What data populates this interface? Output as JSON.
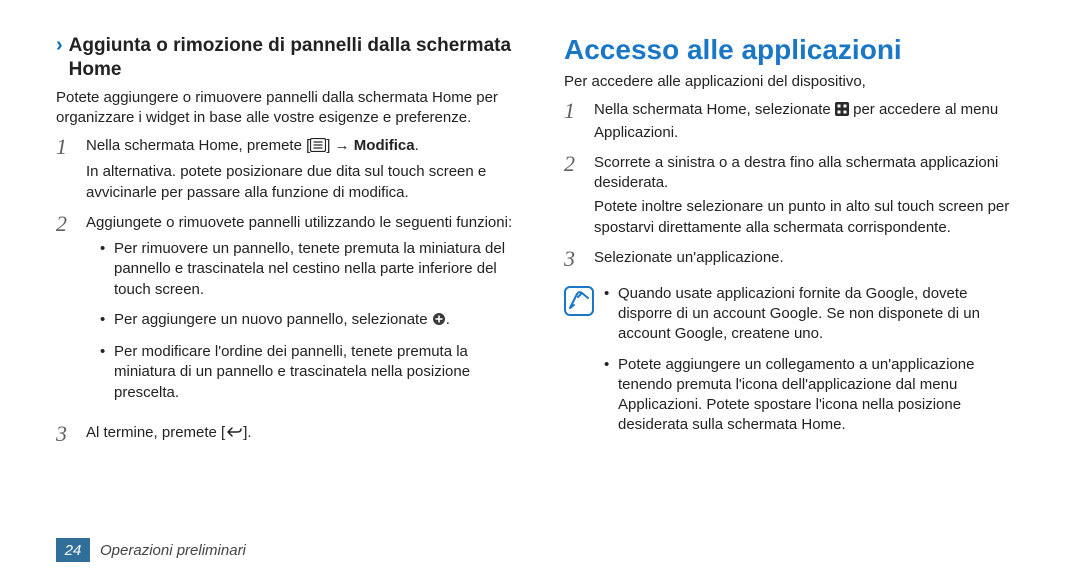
{
  "left": {
    "heading": "Aggiunta o rimozione di pannelli dalla schermata Home",
    "intro": "Potete aggiungere o rimuovere pannelli dalla schermata Home per organizzare i widget in base alle vostre esigenze e preferenze.",
    "step1_a": "Nella schermata Home, premete [",
    "step1_b": "] → ",
    "step1_c": "Modifica",
    "step1_d": ".",
    "step1_extra": "In alternativa. potete posizionare due dita sul touch screen e avvicinarle per passare alla funzione di modifica.",
    "step2": "Aggiungete o rimuovete pannelli utilizzando le seguenti funzioni:",
    "bullet1": "Per rimuovere un pannello, tenete premuta la miniatura del pannello e trascinatela nel cestino nella parte inferiore del touch screen.",
    "bullet2_a": "Per aggiungere un nuovo pannello, selezionate ",
    "bullet2_b": ".",
    "bullet3": "Per modificare l'ordine dei pannelli, tenete premuta la miniatura di un pannello e trascinatela nella posizione prescelta.",
    "step3_a": "Al termine, premete [",
    "step3_b": "]."
  },
  "right": {
    "heading": "Accesso alle applicazioni",
    "intro": "Per accedere alle applicazioni del dispositivo,",
    "step1_a": "Nella schermata Home, selezionate ",
    "step1_b": " per accedere al menu Applicazioni.",
    "step2": "Scorrete a sinistra o a destra fino alla schermata applicazioni desiderata.",
    "step2_extra": "Potete inoltre selezionare un punto in alto sul touch screen per spostarvi direttamente alla schermata corrispondente.",
    "step3": "Selezionate un'applicazione.",
    "note1": "Quando usate applicazioni fornite da Google, dovete disporre di un account Google. Se non disponete di un account Google, createne uno.",
    "note2": "Potete aggiungere un collegamento a un'applicazione tenendo premuta l'icona dell'applicazione dal menu Applicazioni. Potete spostare l'icona nella posizione desiderata sulla schermata Home."
  },
  "footer": {
    "page": "24",
    "section": "Operazioni preliminari"
  }
}
